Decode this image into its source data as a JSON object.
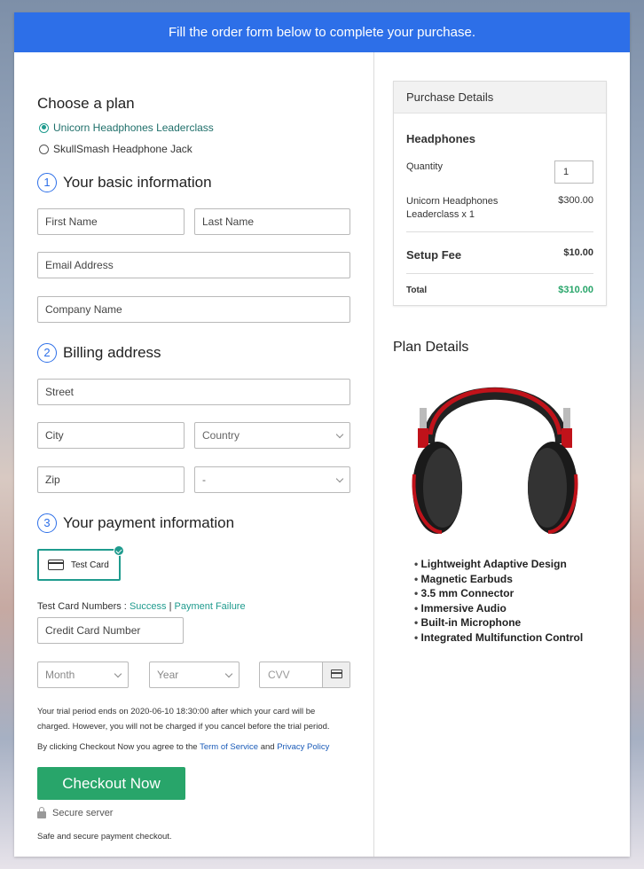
{
  "banner": "Fill the order form below to complete your purchase.",
  "plan": {
    "heading": "Choose a plan",
    "options": [
      "Unicorn Headphones Leaderclass",
      "SkullSmash Headphone Jack"
    ],
    "selected_index": 0
  },
  "basic": {
    "number": "1",
    "heading": "Your basic information",
    "first_name": "First Name",
    "last_name": "Last Name",
    "email": "Email Address",
    "company": "Company Name"
  },
  "billing": {
    "number": "2",
    "heading": "Billing address",
    "street": "Street",
    "city": "City",
    "country": "Country",
    "zip": "Zip",
    "state": "-"
  },
  "payment": {
    "number": "3",
    "heading": "Your payment information",
    "test_card": "Test Card",
    "test_numbers_label": "Test Card Numbers :",
    "success": "Success",
    "separator": "|",
    "failure": "Payment Failure",
    "card_number": "Credit Card Number",
    "month": "Month",
    "year": "Year",
    "cvv": "CVV"
  },
  "legal": {
    "trial": "Your trial period ends on 2020-06-10 18:30:00 after which your card will be charged. However, you will not be charged if you cancel before the trial period.",
    "agree_prefix": "By clicking Checkout Now you agree to the",
    "terms": "Term of Service",
    "and": "and",
    "privacy": "Privacy Policy"
  },
  "checkout": {
    "button": "Checkout Now",
    "secure": "Secure server",
    "safe": "Safe and secure payment checkout."
  },
  "purchase": {
    "heading": "Purchase Details",
    "product": "Headphones",
    "quantity_label": "Quantity",
    "quantity": "1",
    "item": "Unicorn Headphones Leaderclass x 1",
    "item_price": "$300.00",
    "setup_label": "Setup Fee",
    "setup_price": "$10.00",
    "total_label": "Total",
    "total_price": "$310.00",
    "total_color": "#28a56a"
  },
  "plan_details": {
    "heading": "Plan Details",
    "image_icon": "headphones-image",
    "features": [
      "Lightweight Adaptive Design",
      "Magnetic Earbuds",
      "3.5 mm Connector",
      "Immersive Audio",
      "Built-in Microphone",
      "Integrated Multifunction Control"
    ]
  },
  "colors": {
    "banner": "#2d6fe8",
    "accent": "#1f9b8e",
    "checkout": "#28a56a"
  }
}
